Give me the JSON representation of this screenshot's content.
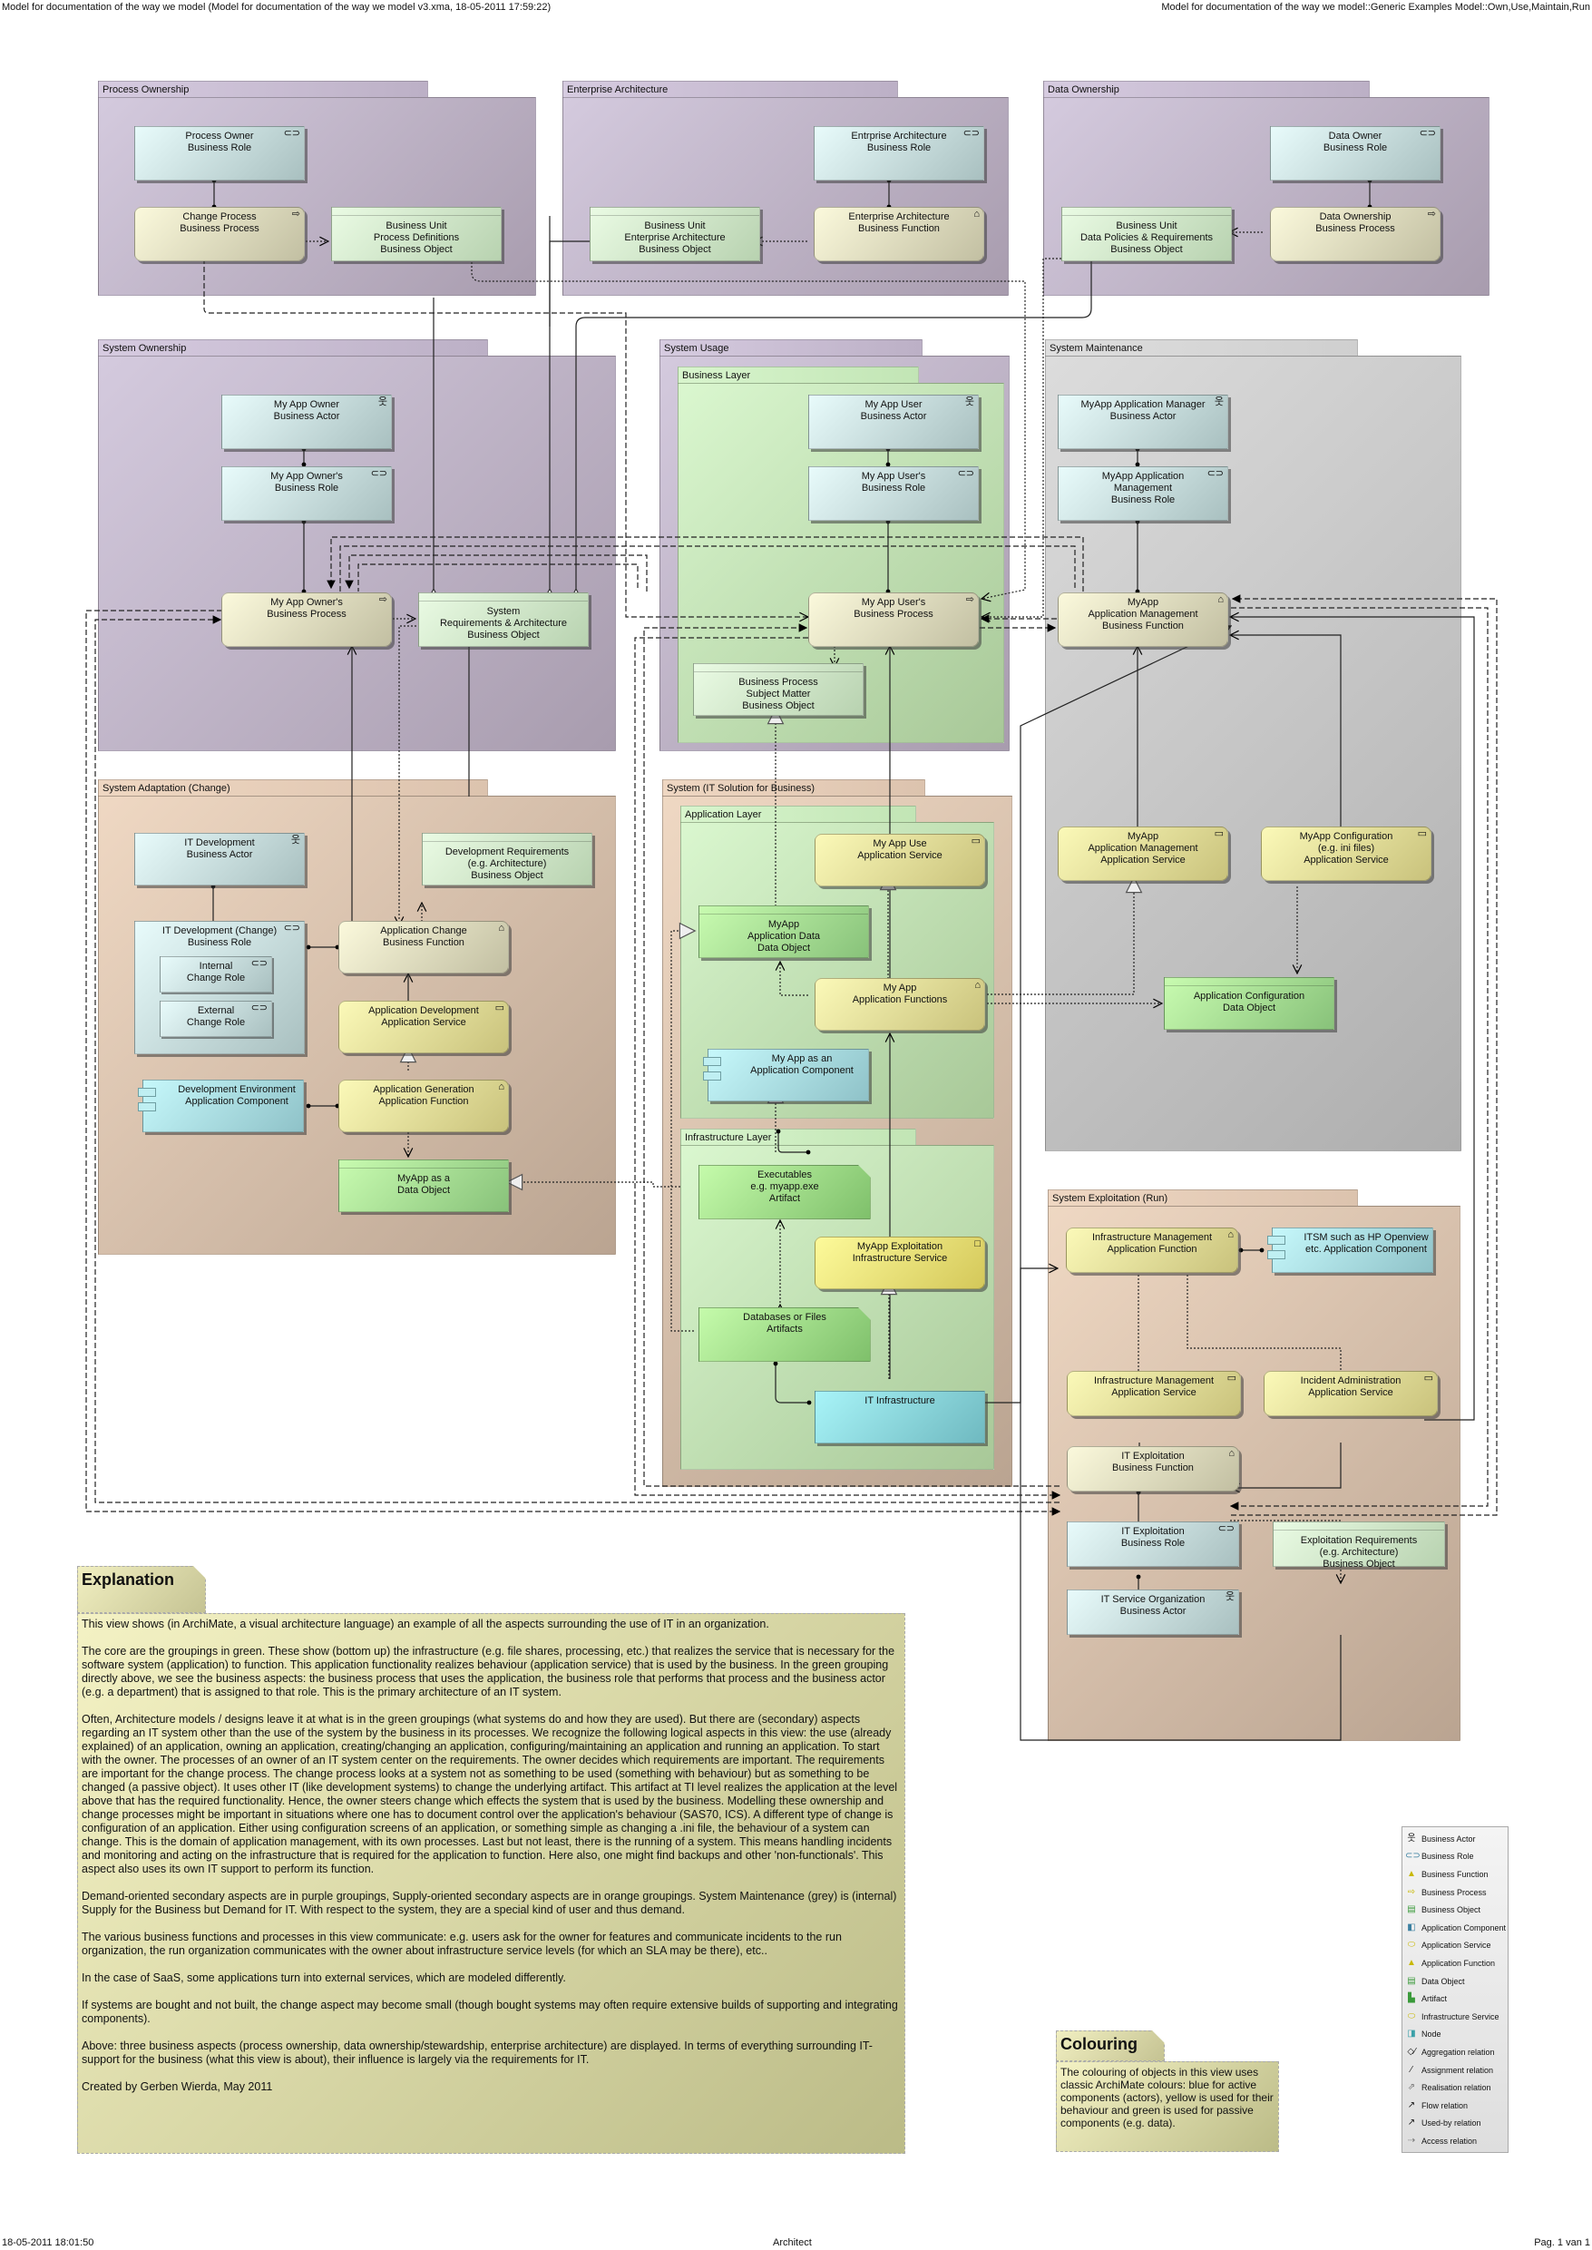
{
  "header": {
    "left": "Model for documentation of the way we model (Model for documentation of the way we model v3.xma, 18-05-2011 17:59:22)",
    "right": "Model for documentation of the way we model::Generic Examples Model::Own,Use,Maintain,Run"
  },
  "footer": {
    "left": "18-05-2011 18:01:50",
    "center": "Architect",
    "right": "Pag. 1 van 1"
  },
  "colors": {
    "demand_grouping": "#bcb0c6",
    "supply_grouping": "#dcc3ae",
    "maintenance_grouping": "#cfcfcf",
    "core_grouping": "#c2e5b5",
    "active_structure": "#c8e4e4",
    "behaviour": "#efeab0",
    "passive_structure": "#d6efcc"
  },
  "groups": {
    "process_ownership": "Process Ownership",
    "enterprise_architecture": "Enterprise Architecture",
    "data_ownership": "Data Ownership",
    "system_ownership": "System Ownership",
    "system_usage": "System Usage",
    "business_layer": "Business Layer",
    "system_maintenance": "System Maintenance",
    "system_adaptation": "System Adaptation (Change)",
    "system_it": "System (IT Solution for Business)",
    "application_layer": "Application Layer",
    "infrastructure_layer": "Infrastructure Layer",
    "system_exploitation": "System Exploitation (Run)"
  },
  "elements": {
    "process_owner_role": {
      "label": "Process Owner\nBusiness Role",
      "icon": "business-role-icon"
    },
    "change_process": {
      "label": "Change Process\nBusiness Process",
      "icon": "business-process-icon"
    },
    "bu_process_definitions": {
      "label": "Business Unit\nProcess Definitions\nBusiness Object"
    },
    "ea_role": {
      "label": "Entrprise Architecture\nBusiness Role",
      "icon": "business-role-icon"
    },
    "ea_function": {
      "label": "Enterprise Architecture\nBusiness Function",
      "icon": "business-function-icon"
    },
    "bu_ea_object": {
      "label": "Business Unit\nEnterprise Architecture\nBusiness Object"
    },
    "data_owner_role": {
      "label": "Data Owner\nBusiness Role",
      "icon": "business-role-icon"
    },
    "data_ownership_process": {
      "label": "Data Ownership\nBusiness Process",
      "icon": "business-process-icon"
    },
    "bu_data_policies": {
      "label": "Business Unit\nData Policies & Requirements\nBusiness Object"
    },
    "app_owner_actor": {
      "label": "My App Owner\nBusiness Actor",
      "icon": "business-actor-icon"
    },
    "app_owner_role": {
      "label": "My App Owner's\nBusiness Role",
      "icon": "business-role-icon"
    },
    "app_owner_process": {
      "label": "My App Owner's\nBusiness Process",
      "icon": "business-process-icon"
    },
    "system_requirements": {
      "label": "System\nRequirements & Architecture\nBusiness Object"
    },
    "app_user_actor": {
      "label": "My App User\nBusiness Actor",
      "icon": "business-actor-icon"
    },
    "app_user_role": {
      "label": "My App User's\nBusiness Role",
      "icon": "business-role-icon"
    },
    "app_user_process": {
      "label": "My App User's\nBusiness Process",
      "icon": "business-process-icon"
    },
    "bp_subject_matter": {
      "label": "Business Process\nSubject Matter\nBusiness Object"
    },
    "app_manager_actor": {
      "label": "MyApp Application Manager\nBusiness Actor",
      "icon": "business-actor-icon"
    },
    "app_mgmt_role": {
      "label": "MyApp Application\nManagement\nBusiness Role",
      "icon": "business-role-icon"
    },
    "app_mgmt_function": {
      "label": "MyApp\nApplication Management\nBusiness Function",
      "icon": "business-function-icon"
    },
    "app_mgmt_service": {
      "label": "MyApp\nApplication Management\nApplication Service",
      "icon": "application-service-icon"
    },
    "app_config_service": {
      "label": "MyApp Configuration\n(e.g. ini files)\nApplication Service",
      "icon": "application-service-icon"
    },
    "app_config_data": {
      "label": "Application Configuration\nData Object"
    },
    "it_dev_actor": {
      "label": "IT Development\nBusiness Actor",
      "icon": "business-actor-icon"
    },
    "it_dev_role": {
      "label": "IT Development (Change)\nBusiness Role",
      "icon": "business-role-icon"
    },
    "internal_change_role": {
      "label": "Internal\nChange Role",
      "icon": "business-role-icon"
    },
    "external_change_role": {
      "label": "External\nChange Role",
      "icon": "business-role-icon"
    },
    "dev_requirements": {
      "label": "Development Requirements\n(e.g. Architecture)\nBusiness Object"
    },
    "app_change_function": {
      "label": "Application Change\nBusiness Function",
      "icon": "business-function-icon"
    },
    "app_dev_service": {
      "label": "Application Development\nApplication Service",
      "icon": "application-service-icon"
    },
    "dev_env_component": {
      "label": "Development Environment\nApplication Component"
    },
    "app_gen_function": {
      "label": "Application Generation\nApplication Function",
      "icon": "application-function-icon"
    },
    "myapp_data_object": {
      "label": "MyApp as a\nData Object"
    },
    "app_use_service": {
      "label": "My App Use\nApplication Service",
      "icon": "application-service-icon"
    },
    "app_data_object": {
      "label": "MyApp\nApplication Data\nData Object"
    },
    "app_functions": {
      "label": "My App\nApplication Functions",
      "icon": "application-function-icon"
    },
    "app_component": {
      "label": "My App as an\nApplication Component"
    },
    "executables": {
      "label": "Executables\ne.g. myapp.exe\nArtifact"
    },
    "exploitation_infra_service": {
      "label": "MyApp Exploitation\nInfrastructure Service",
      "icon": "infrastructure-service-icon"
    },
    "databases_files": {
      "label": "Databases or Files\nArtifacts"
    },
    "it_infrastructure": {
      "label": "IT Infrastructure"
    },
    "infra_mgmt_function": {
      "label": "Infrastructure Management\nApplication Function",
      "icon": "application-function-icon"
    },
    "itsm_component": {
      "label": "ITSM such as HP Openview\netc. Application Component"
    },
    "infra_mgmt_service": {
      "label": "Infrastructure Management\nApplication Service",
      "icon": "application-service-icon"
    },
    "incident_admin_service": {
      "label": "Incident Administration\nApplication Service",
      "icon": "application-service-icon"
    },
    "it_exploitation_function": {
      "label": "IT Exploitation\nBusiness Function",
      "icon": "business-function-icon"
    },
    "it_exploitation_role": {
      "label": "IT Exploitation\nBusiness Role",
      "icon": "business-role-icon"
    },
    "exploitation_requirements": {
      "label": "Exploitation Requirements\n(e.g. Architecture)\nBusiness Object"
    },
    "it_service_org_actor": {
      "label": "IT Service Organization\nBusiness Actor",
      "icon": "business-actor-icon"
    }
  },
  "explanation": {
    "title": "Explanation",
    "paragraphs": [
      "This view shows (in ArchiMate, a visual architecture language) an example of all the aspects surrounding the use of IT in an organization.",
      "The core are the groupings in green. These show (bottom up) the infrastructure (e.g. file shares, processing, etc.) that realizes the service that is necessary for the software system (application) to function. This application functionality realizes behaviour (application service) that is used by the business. In the green grouping directly above, we see the business aspects: the business process that uses the application, the business role that performs that process and the business actor (e.g. a department) that is assigned to that role. This is the primary architecture of an IT system.",
      "Often, Architecture models / designs leave it at what is in the green groupings (what systems do and how they are used). But there are (secondary) aspects regarding an IT system other than the use of the system by the business in its processes. We recognize the following logical aspects in this view: the use (already explained) of an application, owning an application, creating/changing an application, configuring/maintaining an application and running an application. To start with the owner. The processes of an owner of an IT system center on the requirements. The owner decides which requirements are important. The requirements are important for the change process. The change process looks at a system not as something to be used (something with behaviour) but as something to be changed (a passive object). It uses other IT (like development systems) to change the underlying artifact. This artifact at TI level realizes the application at the level above that has the required functionality. Hence, the owner steers change which effects the system that is used by the business. Modelling these ownership and change processes might be important in situations where one has to document control over the application's behaviour (SAS70, ICS). A different type of change is configuration of an application. Either using configuration screens of an application, or something simple as changing a .ini file, the behaviour of a system can change. This is the domain of application management, with its own processes. Last but not least, there is the running of a system. This means handling incidents and monitoring and acting on the infrastructure that is required for the application to function. Here also, one might find backups and other 'non-functionals'. This aspect also uses its own IT support to perform its function.",
      "Demand-oriented secondary aspects are in purple groupings, Supply-oriented secondary aspects are in orange groupings. System Maintenance (grey) is (internal) Supply for the Business but Demand for IT. With respect to the system, they are a special  kind of user and thus demand.",
      "The various business functions and processes in this view communicate: e.g. users ask for the owner for features and communicate incidents to the run organization, the run organization communicates with the owner about infrastructure service levels (for which an SLA may be there), etc..",
      "In the case of SaaS, some applications turn into external services, which are modeled differently.",
      "If systems are bought and not built, the change aspect may become small (though bought systems may often require extensive builds of supporting and integrating components).",
      "Above: three business aspects (process ownership, data ownership/stewardship, enterprise architecture) are displayed. In terms of everything surrounding IT-support for the business (what this view is about), their influence is largely via the requirements for IT.",
      "Created by Gerben Wierda, May 2011"
    ]
  },
  "colouring": {
    "title": "Colouring",
    "text": "The colouring of objects in this view uses classic ArchiMate colours:  blue for active components (actors), yellow is used for their behaviour and green is used for passive components (e.g. data)."
  },
  "legend": [
    {
      "label": "Business Actor",
      "icon": "business-actor-icon"
    },
    {
      "label": "Business Role",
      "icon": "business-role-icon"
    },
    {
      "label": "Business Function",
      "icon": "business-function-icon"
    },
    {
      "label": "Business Process",
      "icon": "business-process-icon"
    },
    {
      "label": "Business Object",
      "icon": "business-object-icon"
    },
    {
      "label": "Application Component",
      "icon": "application-component-icon"
    },
    {
      "label": "Application Service",
      "icon": "application-service-icon"
    },
    {
      "label": "Application Function",
      "icon": "application-function-icon"
    },
    {
      "label": "Data Object",
      "icon": "data-object-icon"
    },
    {
      "label": "Artifact",
      "icon": "artifact-icon"
    },
    {
      "label": "Infrastructure Service",
      "icon": "infrastructure-service-icon"
    },
    {
      "label": "Node",
      "icon": "node-icon"
    },
    {
      "label": "Aggregation relation",
      "icon": "aggregation-relation-icon"
    },
    {
      "label": "Assignment relation",
      "icon": "assignment-relation-icon"
    },
    {
      "label": "Realisation relation",
      "icon": "realisation-relation-icon"
    },
    {
      "label": "Flow relation",
      "icon": "flow-relation-icon"
    },
    {
      "label": "Used-by relation",
      "icon": "used-by-relation-icon"
    },
    {
      "label": "Access relation",
      "icon": "access-relation-icon"
    }
  ]
}
